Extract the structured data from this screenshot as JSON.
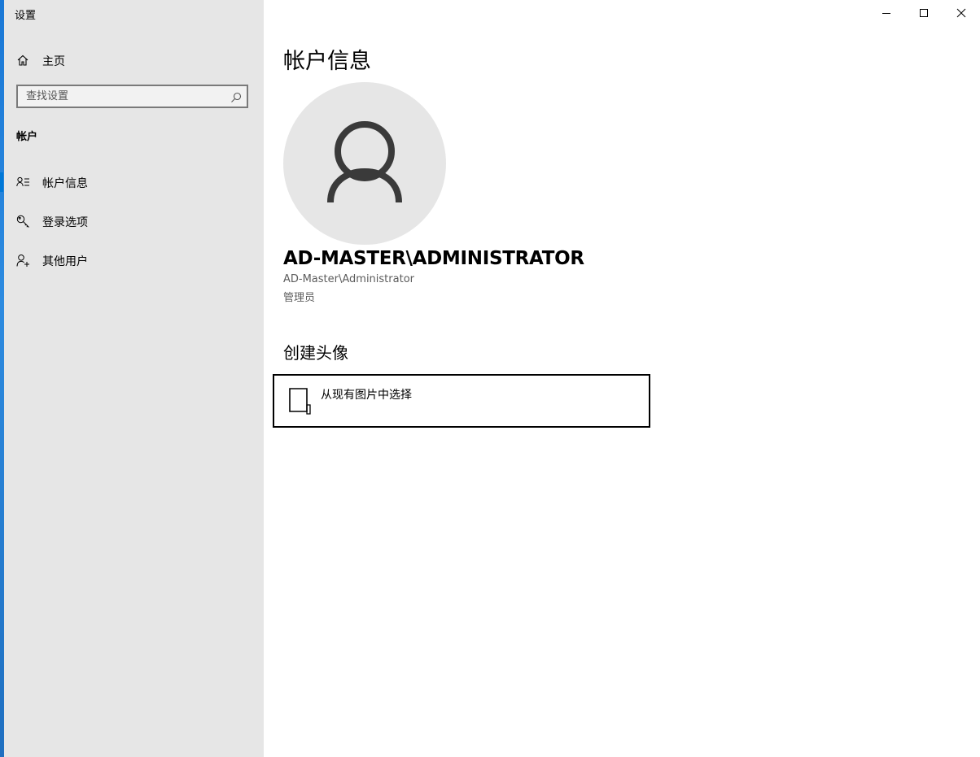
{
  "window": {
    "title": "设置"
  },
  "sidebar": {
    "home_label": "主页",
    "search": {
      "placeholder": "查找设置"
    },
    "section_title": "帐户",
    "items": [
      {
        "label": "帐户信息",
        "icon": "account-info-icon",
        "active": true
      },
      {
        "label": "登录选项",
        "icon": "key-icon",
        "active": false
      },
      {
        "label": "其他用户",
        "icon": "add-person-icon",
        "active": false
      }
    ]
  },
  "caption_buttons": {
    "minimize_icon": "minimize-icon",
    "maximize_icon": "maximize-icon",
    "close_icon": "close-icon"
  },
  "main": {
    "title": "帐户信息",
    "user": {
      "display_name": "AD-MASTER\\ADMINISTRATOR",
      "account": "AD-Master\\Administrator",
      "role": "管理员"
    },
    "create_avatar": {
      "heading": "创建头像",
      "browse_label": "从现有图片中选择",
      "browse_icon": "image-file-icon"
    }
  },
  "colors": {
    "accent": "#0078d7",
    "sidebar_bg": "#e6e6e6",
    "avatar_bg": "#e6e6e6",
    "secondary_text": "#5c5c5c"
  }
}
